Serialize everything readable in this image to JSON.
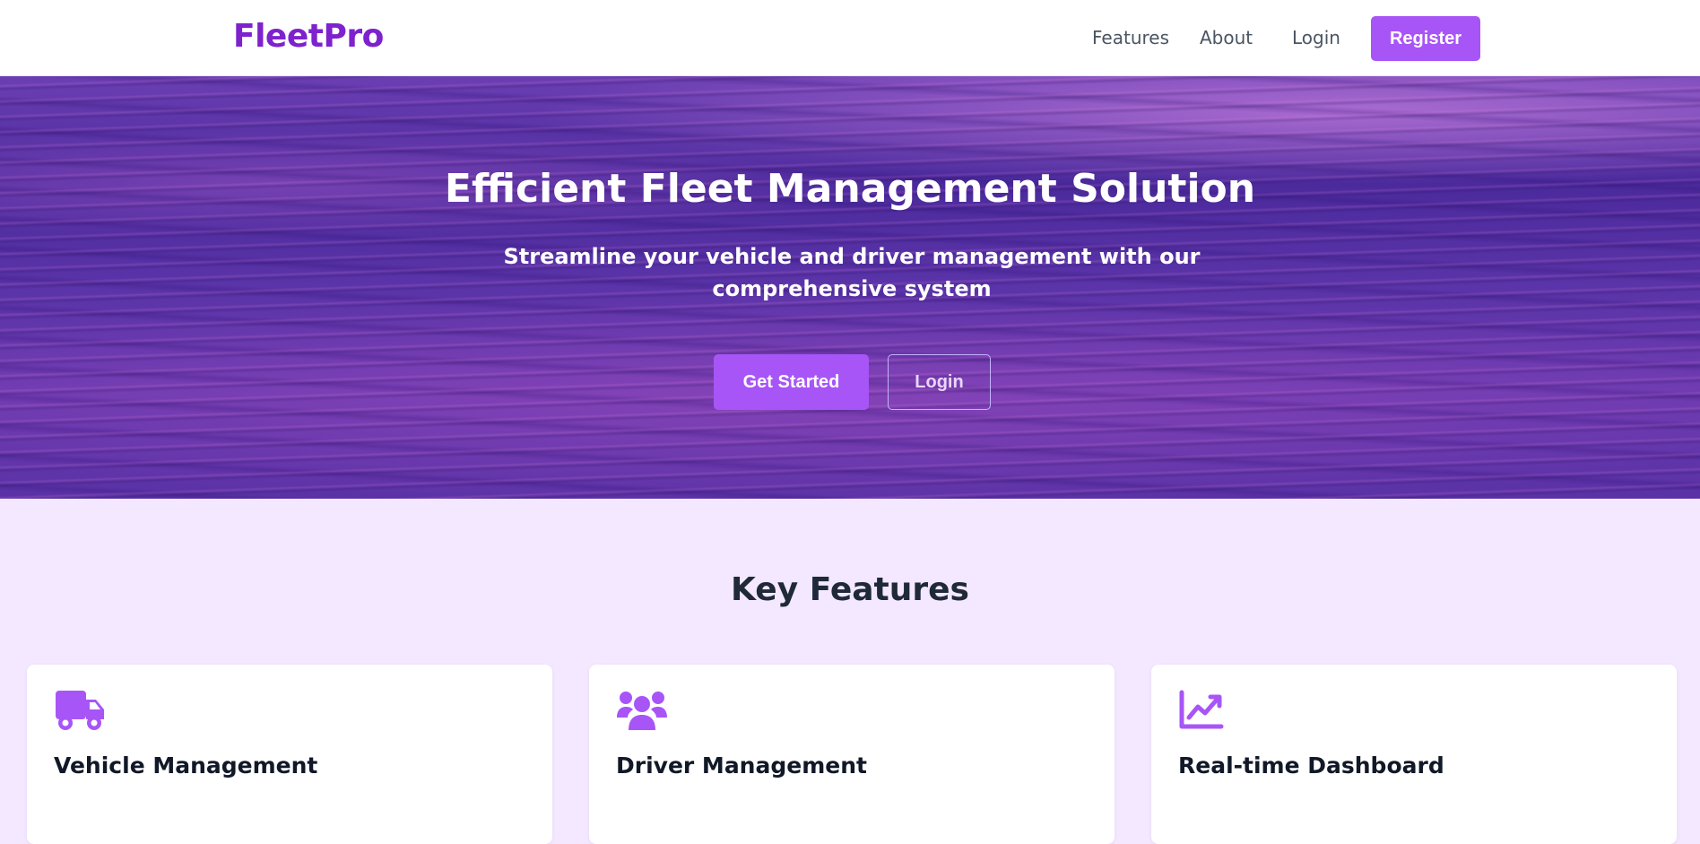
{
  "navbar": {
    "brand": "FleetPro",
    "links": [
      {
        "label": "Features"
      },
      {
        "label": "About"
      },
      {
        "label": "Login"
      }
    ],
    "register_label": "Register"
  },
  "hero": {
    "title": "Efficient Fleet Management Solution",
    "subtitle": "Streamline your vehicle and driver management with our comprehensive system",
    "get_started_label": "Get Started",
    "login_label": "Login"
  },
  "features": {
    "title": "Key Features",
    "cards": [
      {
        "icon": "truck-icon",
        "title": "Vehicle Management"
      },
      {
        "icon": "users-icon",
        "title": "Driver Management"
      },
      {
        "icon": "line-chart-icon",
        "title": "Real-time Dashboard"
      }
    ]
  },
  "colors": {
    "brand": "#7e22ce",
    "accent": "#a855f7",
    "features_background": "#f3e8ff"
  }
}
